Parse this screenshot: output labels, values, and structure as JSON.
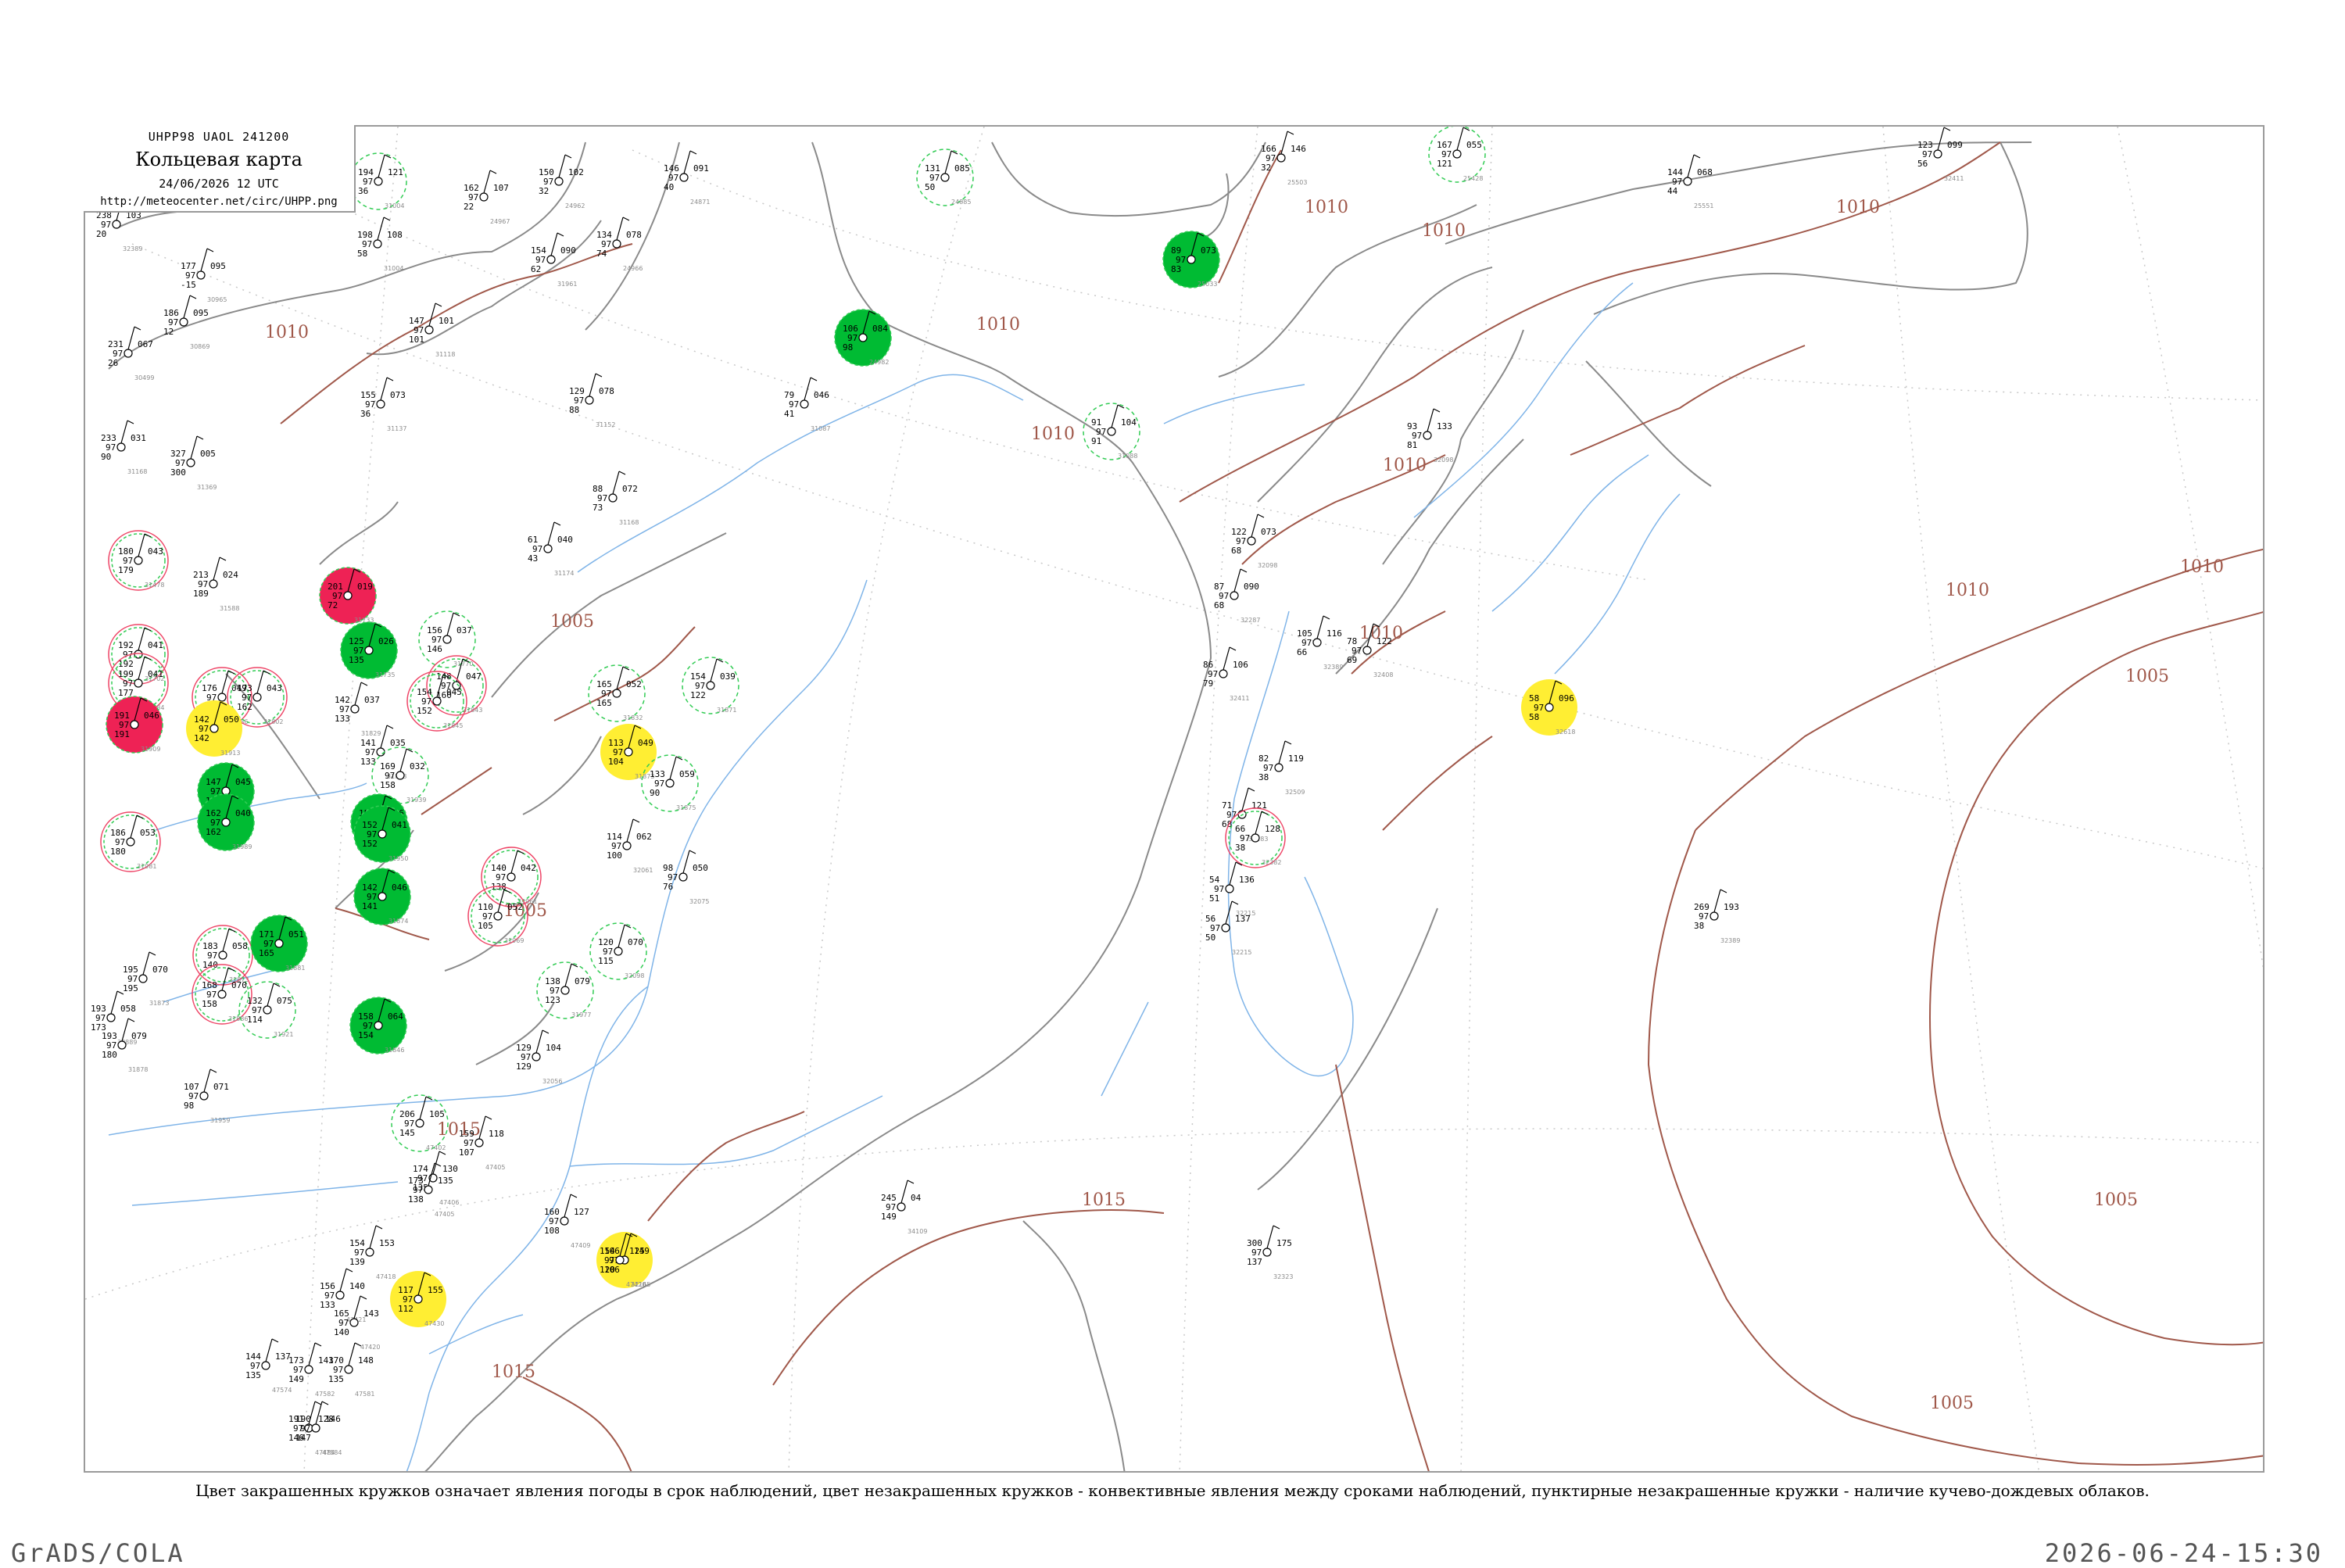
{
  "title_box": {
    "code": "UHPP98  UAOL  241200",
    "title": "Кольцевая карта",
    "datetime": "24/06/2026 12 UTC",
    "url": "http://meteocenter.net/circ/UHPP.png"
  },
  "caption": "Цвет закрашенных кружков означает явления погоды в срок наблюдений, цвет незакрашенных кружков - конвективные явления между сроками наблюдений, пунктирные незакрашенные кружки - наличие кучево-дождевых облаков.",
  "footer": {
    "left": "GrADS/COLA",
    "right": "2026-06-24-15:30"
  },
  "colors": {
    "isobar": "#a0584a",
    "coast": "#9a9a9a",
    "river": "#7fb4e8",
    "green": "#00bb33",
    "red": "#ee2255",
    "yellow": "#ffee33"
  },
  "isobar_labels": [
    "1010",
    "1010",
    "1010",
    "1010",
    "1010",
    "1005",
    "1015",
    "1010",
    "1005",
    "1005",
    "1015",
    "1010",
    "1005",
    "1010",
    "1015",
    "1010",
    "1005",
    "1010"
  ],
  "stations": [
    {
      "l": "194",
      "r": "121",
      "b": "36",
      "i": "31004",
      "c": "cb"
    },
    {
      "l": "162",
      "r": "107",
      "b": "22",
      "i": "24967",
      "c": "none"
    },
    {
      "l": "150",
      "r": "102",
      "b": "32",
      "i": "24962",
      "c": "none"
    },
    {
      "l": "146",
      "r": "091",
      "b": "40",
      "i": "24871",
      "c": "none"
    },
    {
      "l": "131",
      "r": "085",
      "b": "50",
      "i": "24885",
      "c": "cb"
    },
    {
      "l": "166",
      "r": "146",
      "b": "32",
      "i": "25503",
      "c": "none"
    },
    {
      "l": "167",
      "r": "055",
      "b": "121",
      "i": "25428",
      "c": "cb"
    },
    {
      "l": "144",
      "r": "068",
      "b": "44",
      "i": "25551",
      "c": "none"
    },
    {
      "l": "123",
      "r": "099",
      "b": "56",
      "i": "32411",
      "c": "none"
    },
    {
      "l": "238",
      "r": "103",
      "b": "20",
      "i": "32389",
      "c": "none"
    },
    {
      "l": "198",
      "r": "108",
      "b": "58",
      "i": "31004",
      "c": "none"
    },
    {
      "l": "154",
      "r": "090",
      "b": "62",
      "i": "31961",
      "c": "none"
    },
    {
      "l": "134",
      "r": "078",
      "b": "74",
      "i": "24966",
      "c": "none"
    },
    {
      "l": "177",
      "r": "095",
      "b": "-15",
      "i": "30965",
      "c": "none"
    },
    {
      "l": "186",
      "r": "095",
      "b": "12",
      "i": "30869",
      "c": "none"
    },
    {
      "l": "231",
      "r": "067",
      "b": "26",
      "i": "30499",
      "c": "none"
    },
    {
      "l": "147",
      "r": "101",
      "b": "101",
      "i": "31118",
      "c": "none"
    },
    {
      "l": "106",
      "r": "084",
      "b": "98",
      "i": "24982",
      "c": "green"
    },
    {
      "l": "89",
      "r": "073",
      "b": "83",
      "i": "25033",
      "c": "green"
    },
    {
      "l": "79",
      "r": "046",
      "b": "41",
      "i": "31087",
      "c": "none"
    },
    {
      "l": "91",
      "r": "104",
      "b": "91",
      "i": "31088",
      "c": "cb"
    },
    {
      "l": "155",
      "r": "073",
      "b": "36",
      "i": "31137",
      "c": "none"
    },
    {
      "l": "129",
      "r": "078",
      "b": "88",
      "i": "31152",
      "c": "none"
    },
    {
      "l": "233",
      "r": "031",
      "b": "90",
      "i": "31168",
      "c": "none"
    },
    {
      "l": "327",
      "r": "005",
      "b": "300",
      "i": "31369",
      "c": "none"
    },
    {
      "l": "88",
      "r": "072",
      "b": "73",
      "i": "31168",
      "c": "none"
    },
    {
      "l": "61",
      "r": "040",
      "b": "43",
      "i": "31174",
      "c": "none"
    },
    {
      "l": "180",
      "r": "043",
      "b": "179",
      "i": "31478",
      "c": "red"
    },
    {
      "l": "213",
      "r": "024",
      "b": "189",
      "i": "31588",
      "c": "none"
    },
    {
      "l": "201",
      "r": "019",
      "b": "72",
      "i": "31733",
      "c": "redfill"
    },
    {
      "l": "125",
      "r": "026",
      "b": "135",
      "i": "31735",
      "c": "green"
    },
    {
      "l": "156",
      "r": "037",
      "b": "146",
      "i": "31770",
      "c": "cb"
    },
    {
      "l": "192",
      "r": "041",
      "b": "192",
      "i": "31702",
      "c": "red"
    },
    {
      "l": "199",
      "r": "041",
      "b": "177",
      "i": "31784",
      "c": "red"
    },
    {
      "l": "176",
      "r": "049",
      "b": "175",
      "i": "31786",
      "c": "red"
    },
    {
      "l": "173",
      "r": "043",
      "b": "162",
      "i": "31802",
      "c": "red"
    },
    {
      "l": "142",
      "r": "037",
      "b": "133",
      "i": "31829",
      "c": "none"
    },
    {
      "l": "148",
      "r": "047",
      "b": "160",
      "i": "31843",
      "c": "red"
    },
    {
      "l": "154",
      "r": "045",
      "b": "152",
      "i": "31845",
      "c": "red"
    },
    {
      "l": "165",
      "r": "052",
      "b": "165",
      "i": "31832",
      "c": "cb"
    },
    {
      "l": "154",
      "r": "039",
      "b": "122",
      "i": "31871",
      "c": "cb"
    },
    {
      "l": "191",
      "r": "046",
      "b": "191",
      "i": "31909",
      "c": "redfill"
    },
    {
      "l": "142",
      "r": "050",
      "b": "142",
      "i": "31913",
      "c": "yellow"
    },
    {
      "l": "141",
      "r": "035",
      "b": "133",
      "i": "31873",
      "c": "none"
    },
    {
      "l": "169",
      "r": "032",
      "b": "158",
      "i": "31939",
      "c": "cb"
    },
    {
      "l": "147",
      "r": "045",
      "b": "147",
      "i": "31938",
      "c": "green"
    },
    {
      "l": "162",
      "r": "040",
      "b": "162",
      "i": "31989",
      "c": "green"
    },
    {
      "l": "186",
      "r": "053",
      "b": "180",
      "i": "31981",
      "c": "red"
    },
    {
      "l": "154",
      "r": "036",
      "b": "154",
      "i": "31873",
      "c": "green"
    },
    {
      "l": "113",
      "r": "049",
      "b": "104",
      "i": "31873",
      "c": "yellow"
    },
    {
      "l": "133",
      "r": "059",
      "b": "90",
      "i": "31875",
      "c": "cb"
    },
    {
      "l": "152",
      "r": "041",
      "b": "152",
      "i": "31950",
      "c": "green"
    },
    {
      "l": "140",
      "r": "042",
      "b": "138",
      "i": "31961",
      "c": "red"
    },
    {
      "l": "110",
      "r": "052",
      "b": "105",
      "i": "31969",
      "c": "red"
    },
    {
      "l": "114",
      "r": "062",
      "b": "100",
      "i": "32061",
      "c": "none"
    },
    {
      "l": "98",
      "r": "050",
      "b": "76",
      "i": "32075",
      "c": "none"
    },
    {
      "l": "120",
      "r": "070",
      "b": "115",
      "i": "32098",
      "c": "cb"
    },
    {
      "l": "138",
      "r": "079",
      "b": "123",
      "i": "31977",
      "c": "cb"
    },
    {
      "l": "183",
      "r": "058",
      "b": "140",
      "i": "31873",
      "c": "red"
    },
    {
      "l": "171",
      "r": "051",
      "b": "165",
      "i": "31881",
      "c": "green"
    },
    {
      "l": "195",
      "r": "070",
      "b": "195",
      "i": "31873",
      "c": "none"
    },
    {
      "l": "168",
      "r": "070",
      "b": "158",
      "i": "31886",
      "c": "red"
    },
    {
      "l": "193",
      "r": "058",
      "b": "173",
      "i": "38889",
      "c": "none"
    },
    {
      "l": "193",
      "r": "079",
      "b": "180",
      "i": "31878",
      "c": "none"
    },
    {
      "l": "132",
      "r": "075",
      "b": "114",
      "i": "31921",
      "c": "cb"
    },
    {
      "l": "107",
      "r": "071",
      "b": "98",
      "i": "31959",
      "c": "none"
    },
    {
      "l": "158",
      "r": "064",
      "b": "154",
      "i": "31846",
      "c": "green"
    },
    {
      "l": "142",
      "r": "046",
      "b": "141",
      "i": "31874",
      "c": "green"
    },
    {
      "l": "129",
      "r": "104",
      "b": "129",
      "i": "32056",
      "c": "none"
    },
    {
      "l": "206",
      "r": "105",
      "b": "145",
      "i": "47402",
      "c": "cb"
    },
    {
      "l": "174",
      "r": "130",
      "b": "135",
      "i": "47406",
      "c": "none"
    },
    {
      "l": "159",
      "r": "118",
      "b": "107",
      "i": "47405",
      "c": "none"
    },
    {
      "l": "173",
      "r": "135",
      "b": "138",
      "i": "47405",
      "c": "none"
    },
    {
      "l": "160",
      "r": "127",
      "b": "108",
      "i": "47409",
      "c": "none"
    },
    {
      "l": "106",
      "r": "149",
      "b": "106",
      "i": "32165",
      "c": "yellow"
    },
    {
      "l": "154",
      "r": "125",
      "b": "120",
      "i": "47420",
      "c": "none"
    },
    {
      "l": "245",
      "r": "04",
      "b": "149",
      "i": "34109",
      "c": "none"
    },
    {
      "l": "117",
      "r": "155",
      "b": "112",
      "i": "47430",
      "c": "yellow"
    },
    {
      "l": "154",
      "r": "153",
      "b": "139",
      "i": "47418",
      "c": "none"
    },
    {
      "l": "156",
      "r": "140",
      "b": "133",
      "i": "47421",
      "c": "none"
    },
    {
      "l": "165",
      "r": "143",
      "b": "140",
      "i": "47420",
      "c": "none"
    },
    {
      "l": "144",
      "r": "137",
      "b": "135",
      "i": "47574",
      "c": "none"
    },
    {
      "l": "173",
      "r": "143",
      "b": "149",
      "i": "47582",
      "c": "none"
    },
    {
      "l": "170",
      "r": "148",
      "b": "135",
      "i": "47581",
      "c": "none"
    },
    {
      "l": "191",
      "r": "128",
      "b": "146",
      "i": "47484",
      "c": "none"
    },
    {
      "l": "190",
      "r": "146",
      "b": "147",
      "i": "47584",
      "c": "none"
    },
    {
      "l": "122",
      "r": "073",
      "b": "68",
      "i": "32098",
      "c": "none"
    },
    {
      "l": "87",
      "r": "090",
      "b": "68",
      "i": "32287",
      "c": "none"
    },
    {
      "l": "105",
      "r": "116",
      "b": "66",
      "i": "32389",
      "c": "none"
    },
    {
      "l": "78",
      "r": "122",
      "b": "69",
      "i": "32408",
      "c": "none"
    },
    {
      "l": "86",
      "r": "106",
      "b": "79",
      "i": "32411",
      "c": "none"
    },
    {
      "l": "58",
      "r": "096",
      "b": "58",
      "i": "32618",
      "c": "yellow"
    },
    {
      "l": "82",
      "r": "119",
      "b": "38",
      "i": "32509",
      "c": "none"
    },
    {
      "l": "71",
      "r": "121",
      "b": "68",
      "i": "32283",
      "c": "none"
    },
    {
      "l": "66",
      "r": "128",
      "b": "38",
      "i": "32382",
      "c": "red"
    },
    {
      "l": "54",
      "r": "136",
      "b": "51",
      "i": "32215",
      "c": "none"
    },
    {
      "l": "56",
      "r": "137",
      "b": "50",
      "i": "32215",
      "c": "none"
    },
    {
      "l": "93",
      "r": "133",
      "b": "81",
      "i": "32098",
      "c": "none"
    },
    {
      "l": "269",
      "r": "193",
      "b": "38",
      "i": "32389",
      "c": "none"
    },
    {
      "l": "300",
      "r": "175",
      "b": "137",
      "i": "32323",
      "c": "none"
    }
  ]
}
